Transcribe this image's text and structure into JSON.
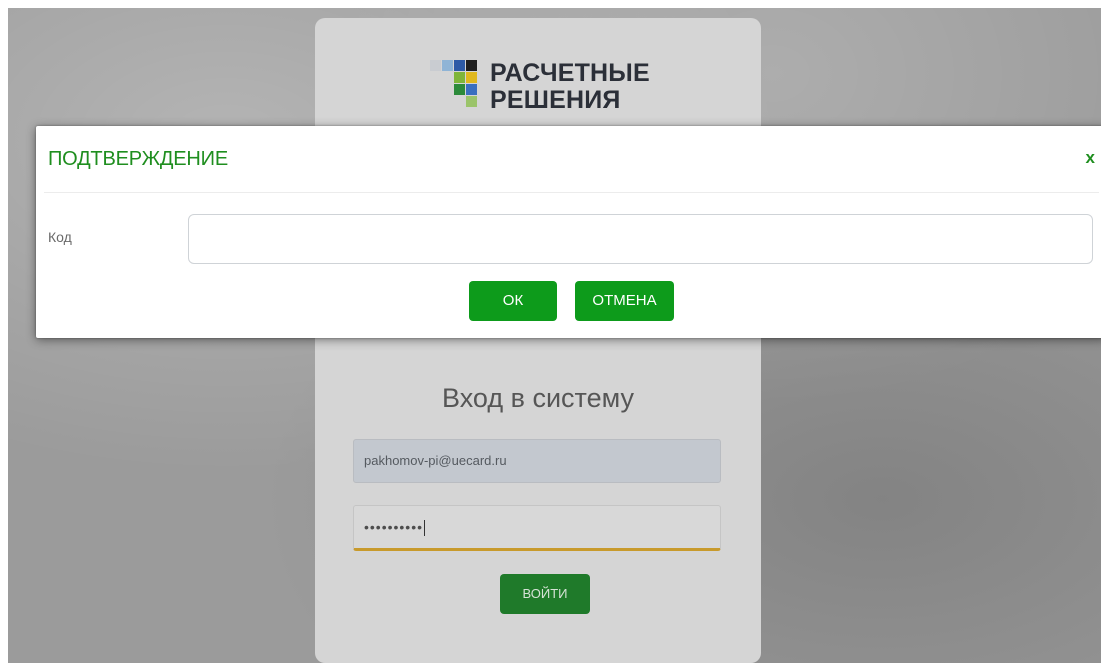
{
  "login": {
    "logo_line1": "РАСЧЕТНЫЕ",
    "logo_line2": "РЕШЕНИЯ",
    "title": "Вход в систему",
    "email_value": "pakhomov-pi@uecard.ru",
    "password_masked": "••••••••••",
    "submit_label": "ВОЙТИ"
  },
  "dialog": {
    "title": "ПОДТВЕРЖДЕНИЕ",
    "close_label": "x",
    "code_label": "Код",
    "code_value": "",
    "ok_label": "ОК",
    "cancel_label": "ОТМЕНА"
  },
  "colors": {
    "accent_green": "#0d9b1b",
    "title_green": "#1f8e1f",
    "password_focus": "#c89a2c"
  },
  "icons": {
    "logo": "squares-logo-icon",
    "close": "close-icon"
  }
}
